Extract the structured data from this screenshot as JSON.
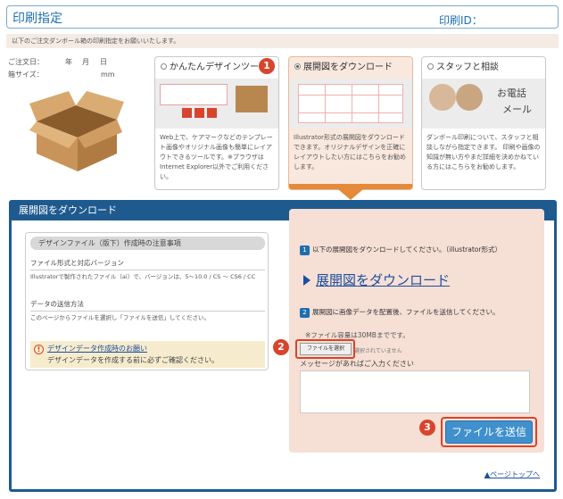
{
  "header": {
    "title": "印刷指定",
    "print_id_label": "印刷ID："
  },
  "notice": "以下のご注文ダンボール箱の印刷指定をお願いいたします。",
  "order_info": {
    "order_date_label": "ご注文日：",
    "year": "年",
    "month": "月",
    "day": "日",
    "box_size_label": "箱サイズ：",
    "unit": "mm"
  },
  "options": [
    {
      "label": "かんたんデザインツール",
      "selected": false,
      "text": "Web上で、ケアマークなどのテンプレート画像やオリジナル画像も簡単にレイアウトできるツールです。※ブラウザはInternet Explorer以外でご利用ください。"
    },
    {
      "label": "展開図をダウンロード",
      "selected": true,
      "text": "Illustrator形式の展開図をダウンロードできます。オリジナルデザインを正確にレイアウトしたい方にはこちらをお勧めします。"
    },
    {
      "label": "スタッフと相談",
      "selected": false,
      "text": "ダンボール印刷について、スタッフと相談しながら指定できます。 印刷や画像の知識が無い方やまだ詳細を決めかねている方にはこちらをお勧めします。",
      "badge_text_1": "お電話",
      "badge_text_2": "メール"
    }
  ],
  "callouts": {
    "one": "1",
    "two": "2",
    "three": "3"
  },
  "panel": {
    "title": "展開図をダウンロード",
    "left": {
      "heading": "デザインファイル（版下）作成時の注意事項",
      "section1_title": "ファイル形式と対応バージョン",
      "section1_text": "Illustratorで製作されたファイル（ai）で、バージョンは、5～10.0 / CS ～ CS6 / CC",
      "section2_title": "データの送信方法",
      "section2_text": "このページからファイルを選択し「ファイルを送信」してください。",
      "warn_icon": "!",
      "warn_link": "デザインデータ作成時のお願い",
      "warn_text": "デザインデータを作成する前に必ずご確認ください。"
    },
    "right": {
      "step1_num": "1",
      "step1_text": "以下の展開図をダウンロードしてください。（illustrator形式）",
      "download_link": "展開図をダウンロード",
      "step2_num": "2",
      "step2_text": "展開図に画像データを配置後、ファイルを送信してください。",
      "limit_text": "※ファイル容量は30MBまでです。",
      "file_button": "ファイルを選択",
      "no_file_text": "選択されていません",
      "message_label": "メッセージがあればご入力ください",
      "message_value": "",
      "send_button": "ファイルを送信"
    },
    "page_top": "▲ページトップへ"
  },
  "colors": {
    "accent": "#1f5a8e",
    "callout": "#d8442c",
    "selected_bg": "#f9e8de",
    "send_button": "#3f90cc"
  }
}
